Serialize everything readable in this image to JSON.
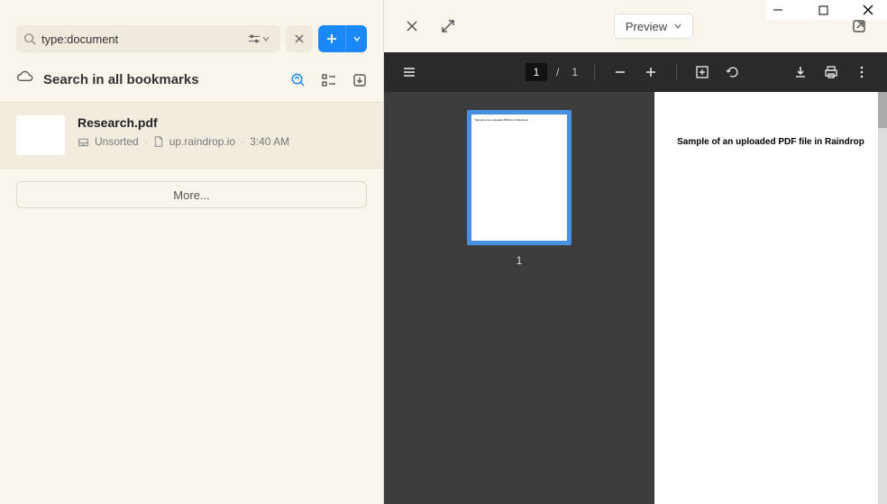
{
  "window": {
    "minimize": "—",
    "maximize": "☐",
    "close": "✕"
  },
  "search": {
    "query": "type:document",
    "tune": "⇄",
    "chev": "▾",
    "close": "✕",
    "add": "+"
  },
  "header": {
    "title": "Search in all bookmarks"
  },
  "item": {
    "title": "Research.pdf",
    "folder": "Unsorted",
    "domain": "up.raindrop.io",
    "time": "3:40 AM",
    "sep": "·"
  },
  "more": {
    "label": "More..."
  },
  "preview": {
    "label": "Preview",
    "chev": "▾"
  },
  "pdf": {
    "page_current": "1",
    "page_sep": "/",
    "page_total": "1",
    "thumb_label": "1",
    "sample_text": "Sample of an uploaded PDF file in Raindrop"
  }
}
